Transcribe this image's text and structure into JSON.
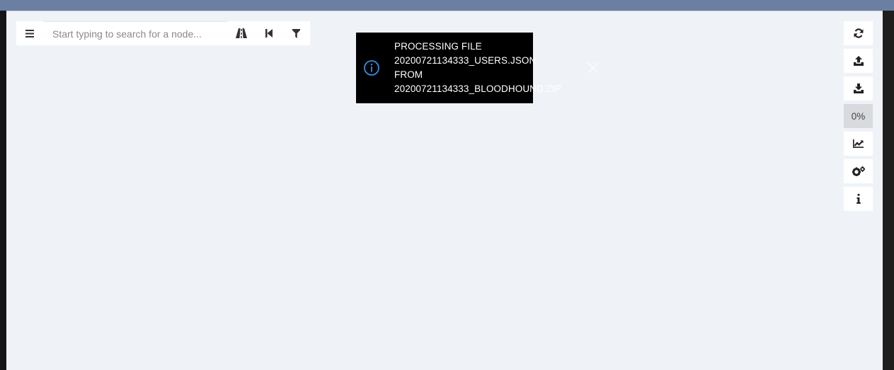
{
  "search": {
    "placeholder": "Start typing to search for a node..."
  },
  "icons": {
    "menu": "bars-icon",
    "pathfinding": "road-icon",
    "back": "step-backward-icon",
    "filter": "filter-icon",
    "info": "info-circle-icon",
    "close": "close-icon",
    "refresh": "refresh-icon",
    "upload": "upload-icon",
    "download": "download-icon",
    "analysis": "line-chart-icon",
    "settings": "cogs-icon",
    "about": "info-icon"
  },
  "toast": {
    "line1": "PROCESSING FILE",
    "line2": "20200721134333_USERS.JSON",
    "line3": "FROM",
    "line4": "20200721134333_BLOODHOUND.ZIP"
  },
  "toolbar": {
    "progress_label": "0%"
  },
  "colors": {
    "canvas": "#eff3f8",
    "toast_bg": "#000000",
    "info_accent": "#2f8fe8"
  }
}
